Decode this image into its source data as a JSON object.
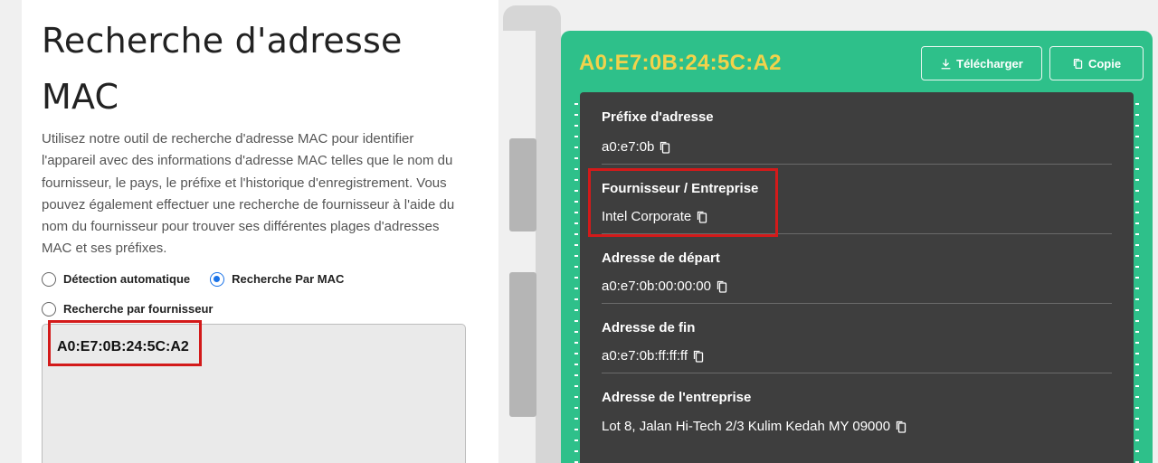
{
  "left": {
    "title_line1": "Recherche d'adresse",
    "title_line2": "MAC",
    "description": "Utilisez notre outil de recherche d'adresse MAC pour identifier l'appareil avec des informations d'adresse MAC telles que le nom du fournisseur, le pays, le préfixe et l'historique d'enregistrement. Vous pouvez également effectuer une recherche de fournisseur à l'aide du nom du fournisseur pour trouver ses différentes plages d'adresses MAC et ses préfixes.",
    "radio_options": [
      {
        "label": "Détection automatique",
        "checked": false
      },
      {
        "label": "Recherche Par MAC",
        "checked": true
      },
      {
        "label": "Recherche par fournisseur",
        "checked": false
      }
    ],
    "input_value": "A0:E7:0B:24:5C:A2"
  },
  "result": {
    "mac": "A0:E7:0B:24:5C:A2",
    "download_label": "Télécharger",
    "copy_label": "Copie",
    "rows": [
      {
        "label": "Préfixe d'adresse",
        "value": "a0:e7:0b"
      },
      {
        "label": "Fournisseur / Entreprise",
        "value": "Intel Corporate"
      },
      {
        "label": "Adresse de départ",
        "value": "a0:e7:0b:00:00:00"
      },
      {
        "label": "Adresse de fin",
        "value": "a0:e7:0b:ff:ff:ff"
      },
      {
        "label": "Adresse de l'entreprise",
        "value": "Lot 8, Jalan Hi-Tech 2/3 Kulim Kedah MY 09000"
      }
    ]
  },
  "colors": {
    "accent_green": "#2ec08a",
    "mac_yellow": "#f2d24b",
    "card_dark": "#3e3e3e",
    "highlight_red": "#d31a1a",
    "radio_blue": "#1a73e8"
  },
  "icons": {
    "download": "download-icon",
    "copy": "copy-icon"
  }
}
